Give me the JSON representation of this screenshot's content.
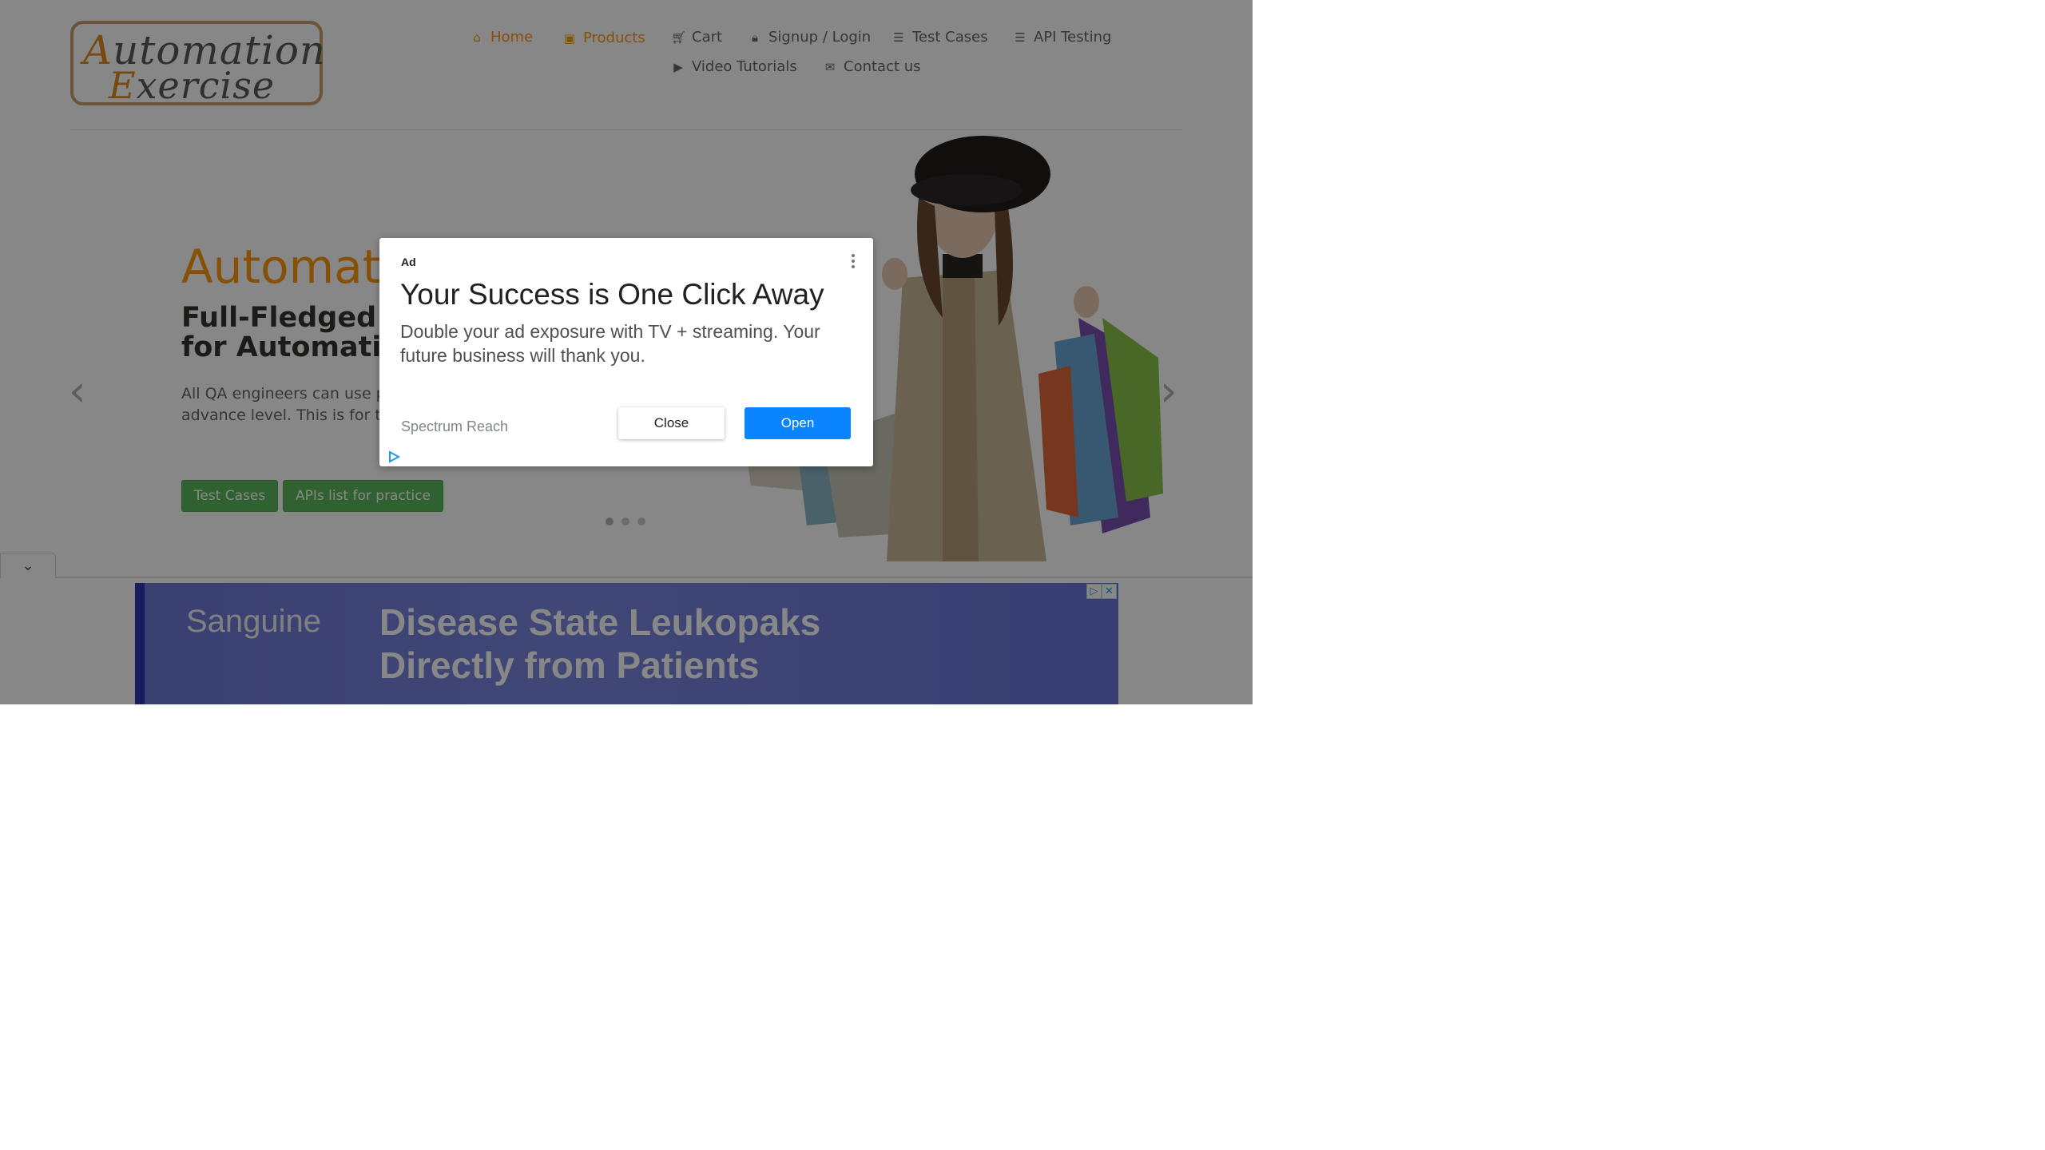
{
  "logo": {
    "line1": "Automation",
    "line2": "Exercise"
  },
  "nav": {
    "items": [
      {
        "label": "Home",
        "icon": "home-icon",
        "active": true
      },
      {
        "label": "Products",
        "icon": "briefcase-icon",
        "active": true
      },
      {
        "label": "Cart",
        "icon": "cart-icon",
        "active": false
      },
      {
        "label": "Signup / Login",
        "icon": "lock-icon",
        "active": false
      },
      {
        "label": "Test Cases",
        "icon": "list-icon",
        "active": false
      },
      {
        "label": "API Testing",
        "icon": "list-icon",
        "active": false
      },
      {
        "label": "Video Tutorials",
        "icon": "youtube-icon",
        "active": false
      },
      {
        "label": "Contact us",
        "icon": "envelope-icon",
        "active": false
      }
    ]
  },
  "hero": {
    "title": "Automat",
    "subtitle": "Full-Fledged \nfor Automati",
    "text": "All QA engineers can use practice and API testing e advance level. This is for their automation skills.",
    "buttons": {
      "test_cases": "Test Cases",
      "apis": "APIs list for practice"
    },
    "prev_arrow": "‹",
    "next_arrow": "›"
  },
  "modal_ad": {
    "label": "Ad",
    "headline": "Your Success is One Click Away",
    "body": "Double your ad exposure with TV + streaming. Your future business will thank you.",
    "advertiser": "Spectrum Reach",
    "close_label": "Close",
    "open_label": "Open"
  },
  "bottom_ad": {
    "brand": "Sanguine",
    "headline_line1": "Disease State Leukopaks",
    "headline_line2": "Directly from Patients"
  },
  "colors": {
    "accent": "#fe980f",
    "button_green": "#5cb85c",
    "open_blue": "#0a84ff",
    "overlay": "rgba(0,0,0,0.47)"
  }
}
